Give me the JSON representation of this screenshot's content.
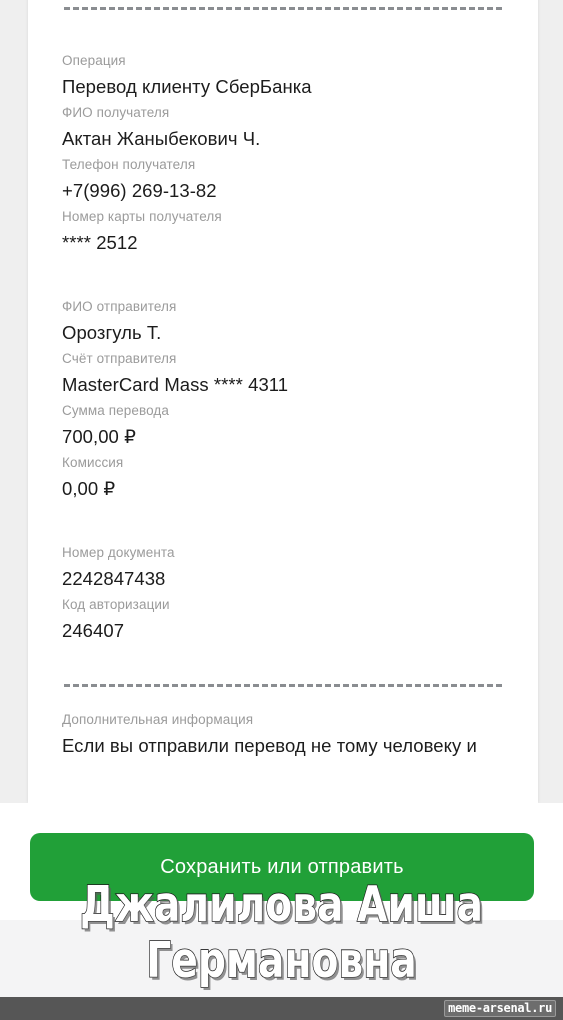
{
  "receipt": {
    "top_divider": "dashed-line",
    "bottom_divider": "dashed-line",
    "sections": [
      {
        "name": "operation",
        "fields": [
          {
            "label": "Операция",
            "value": "Перевод клиенту СберБанка"
          },
          {
            "label": "ФИО получателя",
            "value": "Актан Жаныбекович Ч."
          },
          {
            "label": "Телефон получателя",
            "value": "+7(996) 269-13-82"
          },
          {
            "label": "Номер карты получателя",
            "value": "**** 2512"
          }
        ]
      },
      {
        "name": "sender",
        "fields": [
          {
            "label": "ФИО отправителя",
            "value": "Орозгуль Т."
          },
          {
            "label": "Счёт отправителя",
            "value": "MasterCard Mass **** 4311"
          },
          {
            "label": "Сумма перевода",
            "value": "700,00 ₽"
          },
          {
            "label": "Комиссия",
            "value": "0,00 ₽"
          }
        ]
      },
      {
        "name": "document",
        "fields": [
          {
            "label": "Номер документа",
            "value": "2242847438"
          },
          {
            "label": "Код авторизации",
            "value": "246407"
          }
        ]
      },
      {
        "name": "additional",
        "fields": [
          {
            "label": "Дополнительная информация",
            "value": "Если вы отправили перевод не тому человеку и"
          }
        ]
      }
    ]
  },
  "action_bar": {
    "save_button_label": "Сохранить или отправить",
    "save_button_color": "#21a038"
  },
  "meme": {
    "line1": "Джалилова Аиша",
    "line2": "Германовна",
    "text_color": "#ffffff",
    "outline_color": "#1a1a1a"
  },
  "footer": {
    "watermark": "meme-arsenal.ru",
    "bar_color": "#565656"
  }
}
